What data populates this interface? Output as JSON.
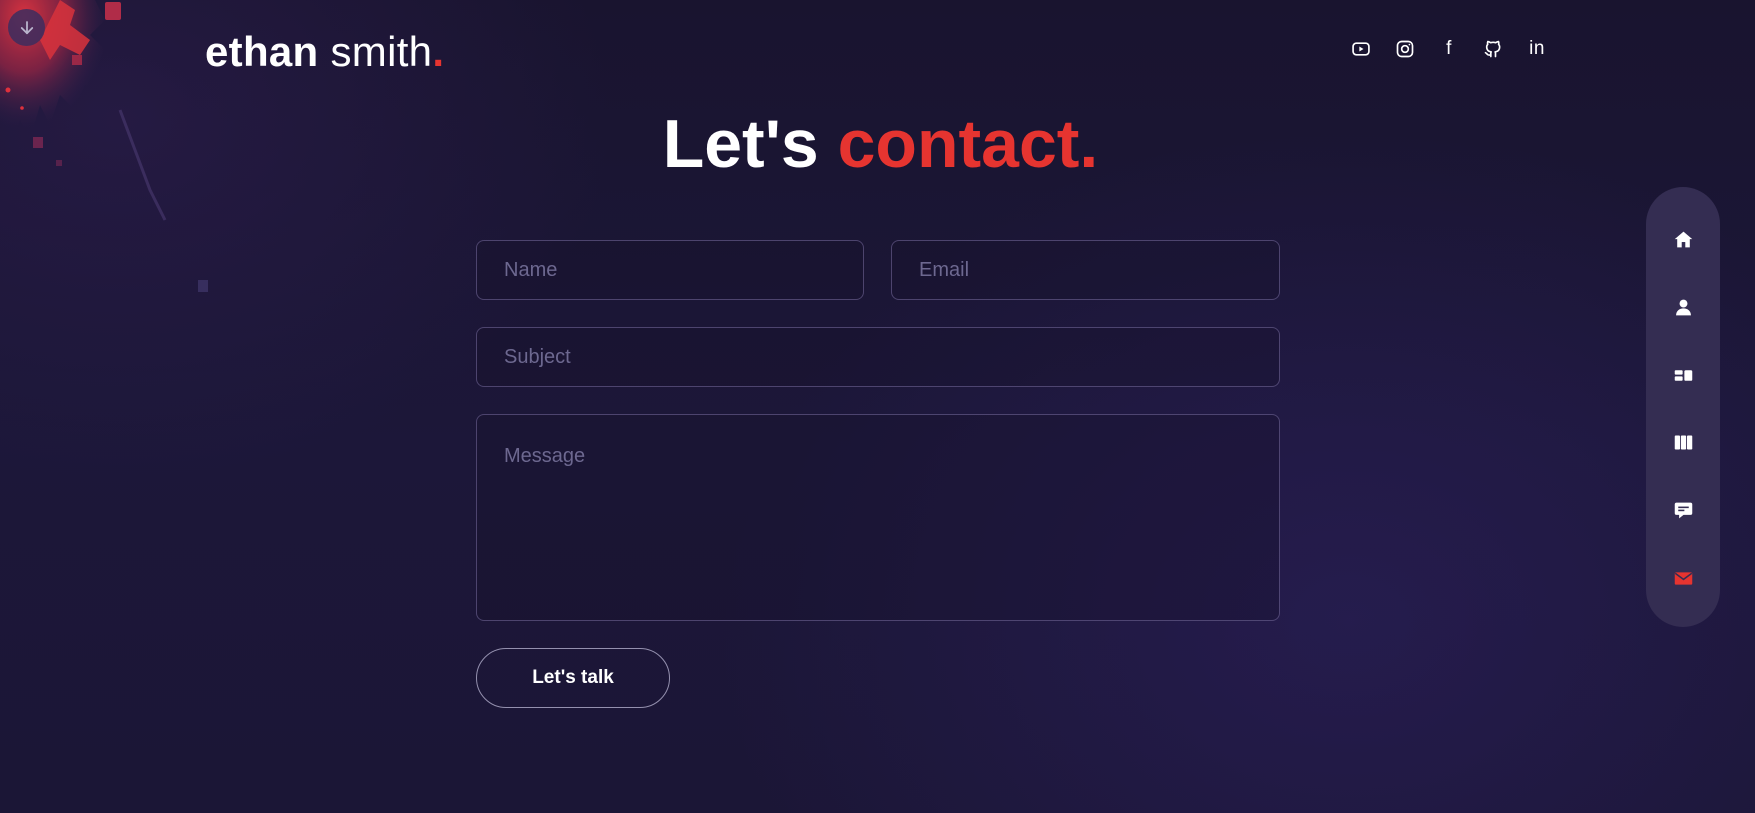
{
  "brand": {
    "first": "ethan",
    "last": "smith",
    "dot": "."
  },
  "socials": [
    {
      "icon": "youtube-icon"
    },
    {
      "icon": "instagram-icon"
    },
    {
      "icon": "facebook-icon",
      "text": "f"
    },
    {
      "icon": "github-icon"
    },
    {
      "icon": "linkedin-icon",
      "text": "in"
    }
  ],
  "heading": {
    "plain": "Let's",
    "accent": "contact."
  },
  "form": {
    "name_placeholder": "Name",
    "email_placeholder": "Email",
    "subject_placeholder": "Subject",
    "message_placeholder": "Message",
    "submit_label": "Let's talk"
  },
  "sidenav": {
    "items": [
      {
        "icon": "home-icon"
      },
      {
        "icon": "user-icon"
      },
      {
        "icon": "services-icon"
      },
      {
        "icon": "portfolio-icon"
      },
      {
        "icon": "testimonial-icon"
      },
      {
        "icon": "mail-icon",
        "active": true
      }
    ]
  },
  "colors": {
    "accent": "#e63430",
    "background": "#1a1535",
    "sidenav": "#342d52"
  }
}
